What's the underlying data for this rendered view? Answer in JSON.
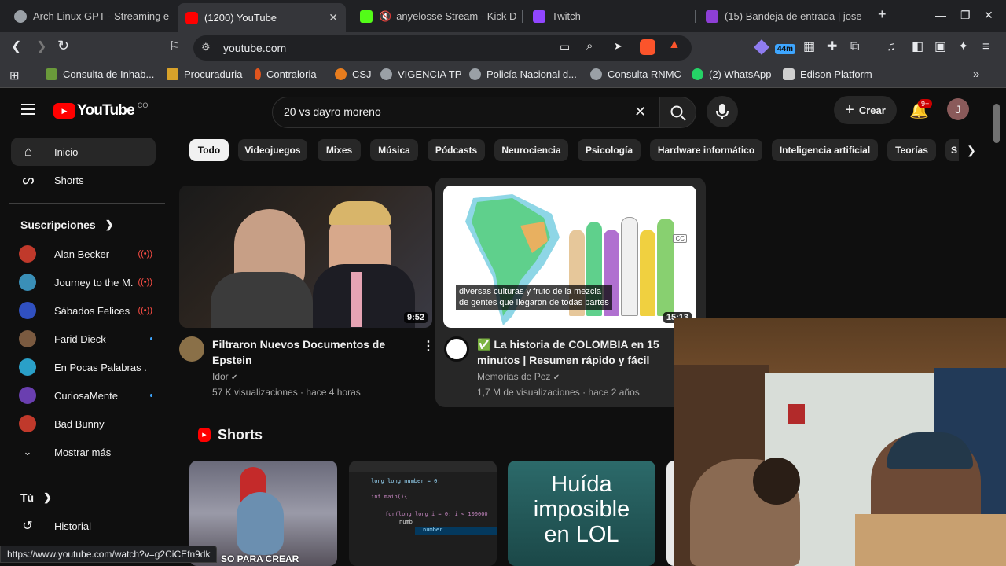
{
  "browser": {
    "tabs": [
      {
        "label": "Arch Linux GPT - Streaming e",
        "fav_color": "#9aa0a6"
      },
      {
        "label": "(1200) YouTube",
        "fav_color": "#ff0000"
      },
      {
        "label": "anyelosse Stream - Kick De",
        "fav_color": "#53fc18"
      },
      {
        "label": "Twitch",
        "fav_color": "#9146ff"
      },
      {
        "label": "(15) Bandeja de entrada | jose",
        "fav_color": "#8e3fd6"
      }
    ],
    "address": "youtube.com",
    "timer_badge": "44m",
    "bookmarks": [
      {
        "label": "Consulta de Inhab...",
        "color": "#6a9a3a"
      },
      {
        "label": "Procuraduria",
        "color": "#d8a22a"
      },
      {
        "label": "Contraloria",
        "color": "#e0551e"
      },
      {
        "label": "CSJ",
        "color": "#e87d1e"
      },
      {
        "label": "VIGENCIA TP",
        "color": "#9aa0a6"
      },
      {
        "label": "Policía Nacional d...",
        "color": "#9aa0a6"
      },
      {
        "label": "Consulta RNMC",
        "color": "#9aa0a6"
      },
      {
        "label": "(2) WhatsApp",
        "color": "#25d366"
      },
      {
        "label": "Edison Platform",
        "color": "#cfcfcf"
      }
    ]
  },
  "youtube": {
    "logo_text": "YouTube",
    "logo_country": "CO",
    "search_value": "20 vs dayro moreno",
    "create_label": "Crear",
    "notif_badge": "9+",
    "avatar_letter": "J",
    "nav": [
      {
        "label": "Inicio",
        "icon": "home-icon"
      },
      {
        "label": "Shorts",
        "icon": "shorts-icon"
      }
    ],
    "subscriptions_title": "Suscripciones",
    "subscriptions": [
      {
        "name": "Alan Becker",
        "status": "live",
        "color": "#c0392b"
      },
      {
        "name": "Journey to the M...",
        "status": "live",
        "color": "#3a8fb7"
      },
      {
        "name": "Sábados Felices",
        "status": "live",
        "color": "#3050c0"
      },
      {
        "name": "Farid Dieck",
        "status": "new",
        "color": "#7a5a40"
      },
      {
        "name": "En Pocas Palabras ...",
        "status": "",
        "color": "#2aa0c8"
      },
      {
        "name": "CuriosaMente",
        "status": "new",
        "color": "#6a3fb0"
      },
      {
        "name": "Bad Bunny",
        "status": "",
        "color": "#c0392b"
      }
    ],
    "show_more": "Mostrar más",
    "you_title": "Tú",
    "history": "Historial",
    "chips": [
      "Todo",
      "Videojuegos",
      "Mixes",
      "Música",
      "Pódcasts",
      "Neurociencia",
      "Psicología",
      "Hardware informático",
      "Inteligencia artificial",
      "Teorías",
      "S"
    ],
    "videos": [
      {
        "title_line1": "Filtraron Nuevos Documentos de",
        "title_line2": "Epstein",
        "channel": "Idor",
        "meta": "57 K visualizaciones · hace 4 horas",
        "duration": "9:52"
      },
      {
        "title_line1": "✅ La historia de COLOMBIA en 15",
        "title_line2": "minutos | Resumen rápido y fácil",
        "channel": "Memorias de Pez",
        "meta": "1,7 M de visualizaciones · hace 2 años",
        "duration": "15:13",
        "caption_line1": "diversas culturas y fruto de la mezcla",
        "caption_line2": "de gentes que llegaron de todas partes",
        "cc": "CC"
      }
    ],
    "shorts_title": "Shorts",
    "shorts": [
      {
        "caption": "SO PARA CREAR"
      },
      {
        "code_lines": [
          "long long number = 0;",
          "int main(){",
          "for(long long i = 0; i < 100000",
          "numb",
          "number"
        ]
      },
      {
        "text_lines": [
          "Huída",
          "imposible",
          "en LOL"
        ]
      }
    ],
    "status_url": "https://www.youtube.com/watch?v=g2CiCEfn9dk"
  }
}
